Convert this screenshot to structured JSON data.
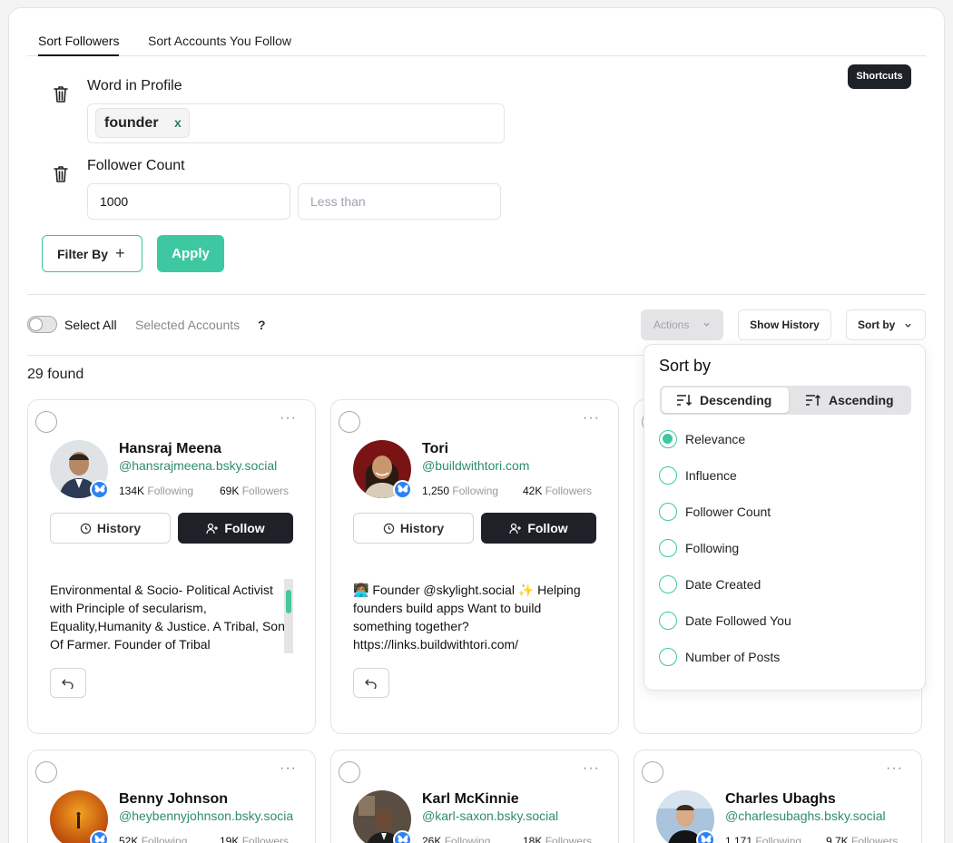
{
  "tabs": [
    "Sort Followers",
    "Sort Accounts You Follow"
  ],
  "shortcuts_label": "Shortcuts",
  "filters": {
    "word_label": "Word in Profile",
    "word_chip": "founder",
    "chip_remove": "x",
    "count_label": "Follower Count",
    "count_value": "1000",
    "count_placeholder": "Less than",
    "filter_by_label": "Filter By",
    "apply_label": "Apply"
  },
  "toolbar": {
    "select_all": "Select All",
    "selected_accounts": "Selected Accounts",
    "help": "?",
    "actions": "Actions",
    "show_history": "Show History",
    "sort_by": "Sort by"
  },
  "found": "29  found",
  "sort_menu": {
    "title": "Sort by",
    "descending": "Descending",
    "ascending": "Ascending",
    "options": [
      "Relevance",
      "Influence",
      "Follower Count",
      "Following",
      "Date Created",
      "Date Followed You",
      "Number of Posts"
    ],
    "selected": "Relevance",
    "order": "Descending"
  },
  "card_buttons": {
    "history": "History",
    "follow": "Follow",
    "more": "···"
  },
  "cards": [
    {
      "name": "Hansraj Meena",
      "handle": "@hansrajmeena.bsky.social",
      "following": "134K",
      "followers": "69K",
      "bio": "Environmental & Socio- Political Activist with Principle of secularism, Equality,Humanity & Justice. A Tribal, Son Of Farmer. Founder of Tribal"
    },
    {
      "name": "Tori",
      "handle": "@buildwithtori.com",
      "following": "1,250",
      "followers": "42K",
      "bio": "👩🏽‍💻 Founder @skylight.social ✨ Helping founders build apps Want to build something together? https://links.buildwithtori.com/"
    },
    {
      "name": "Benny Johnson",
      "handle": "@heybennyjohnson.bsky.social",
      "following": "52K",
      "followers": "19K"
    },
    {
      "name": "Karl McKinnie",
      "handle": "@karl-saxon.bsky.social",
      "following": "26K",
      "followers": "18K"
    },
    {
      "name": "Charles Ubaghs",
      "handle": "@charlesubaghs.bsky.social",
      "following": "1,171",
      "followers": "9.7K"
    }
  ],
  "stat_labels": {
    "following": "Following",
    "followers": "Followers"
  },
  "colors": {
    "accent": "#3ec8a1",
    "dark": "#1f2128",
    "handle": "#2e8b73",
    "bluesky": "#2b82f5"
  }
}
